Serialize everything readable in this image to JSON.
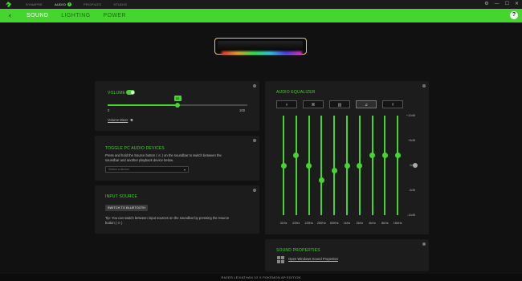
{
  "titlebar": {
    "tabs": [
      {
        "label": "SYNAPSE"
      },
      {
        "label": "AUDIO",
        "badge": "1"
      },
      {
        "label": "PROFILES"
      },
      {
        "label": "STUDIO"
      }
    ],
    "controls": {
      "settings": "⚙",
      "minimize": "—",
      "maximize": "☐",
      "close": "✕"
    }
  },
  "header": {
    "back": "‹",
    "tabs": [
      {
        "label": "SOUND"
      },
      {
        "label": "LIGHTING"
      },
      {
        "label": "POWER"
      }
    ],
    "active_tab": "SOUND",
    "help": "?"
  },
  "volume": {
    "title": "VOLUME",
    "enabled": true,
    "value": 50,
    "value_label": "50",
    "min_label": "0",
    "max_label": "100",
    "mixer_link": "Volume Mixer"
  },
  "toggle_devices": {
    "title": "TOGGLE PC AUDIO DEVICES",
    "desc_line1": "Press and hold the Source button ( ⊙ ) on the soundbar to switch between the",
    "desc_line2": "soundbar and another playback device below.",
    "select_placeholder": "Select a device"
  },
  "input_source": {
    "title": "INPUT SOURCE",
    "button": "SWITCH TO BLUETOOTH",
    "tip_line1": "Tip: You can switch between input sources on the soundbar by pressing the Source",
    "tip_line2": "button ( ⊙ )"
  },
  "equalizer": {
    "title": "AUDIO EQUALIZER",
    "presets": [
      {
        "icon": "eq-sliders-icon",
        "glyph": "⫲"
      },
      {
        "icon": "gamepad-icon",
        "glyph": "⌘"
      },
      {
        "icon": "film-icon",
        "glyph": "▥"
      },
      {
        "icon": "music-note-icon",
        "glyph": "♫"
      },
      {
        "icon": "custom-eq-icon",
        "glyph": "⫩"
      }
    ],
    "selected_preset": 3,
    "db_labels": [
      "+10dB",
      "+5dB",
      "0dB",
      "-5dB",
      "-10dB"
    ],
    "bands": [
      {
        "freq": "31Hz",
        "gain": 0
      },
      {
        "freq": "63Hz",
        "gain": 2
      },
      {
        "freq": "125Hz",
        "gain": 0
      },
      {
        "freq": "250Hz",
        "gain": -3
      },
      {
        "freq": "500Hz",
        "gain": -1
      },
      {
        "freq": "1kHz",
        "gain": 0
      },
      {
        "freq": "2kHz",
        "gain": 0
      },
      {
        "freq": "4kHz",
        "gain": 2
      },
      {
        "freq": "8kHz",
        "gain": 2
      },
      {
        "freq": "16kHz",
        "gain": 2
      }
    ]
  },
  "sound_properties": {
    "title": "SOUND PROPERTIES",
    "link": "Open Windows Sound Properties"
  },
  "footer": {
    "device": "RAZER LEVIATHAN V2 X POKÉMON AP EDITION"
  },
  "colors": {
    "accent": "#44d62c",
    "panel": "#1c1c1c",
    "background": "#111111"
  }
}
